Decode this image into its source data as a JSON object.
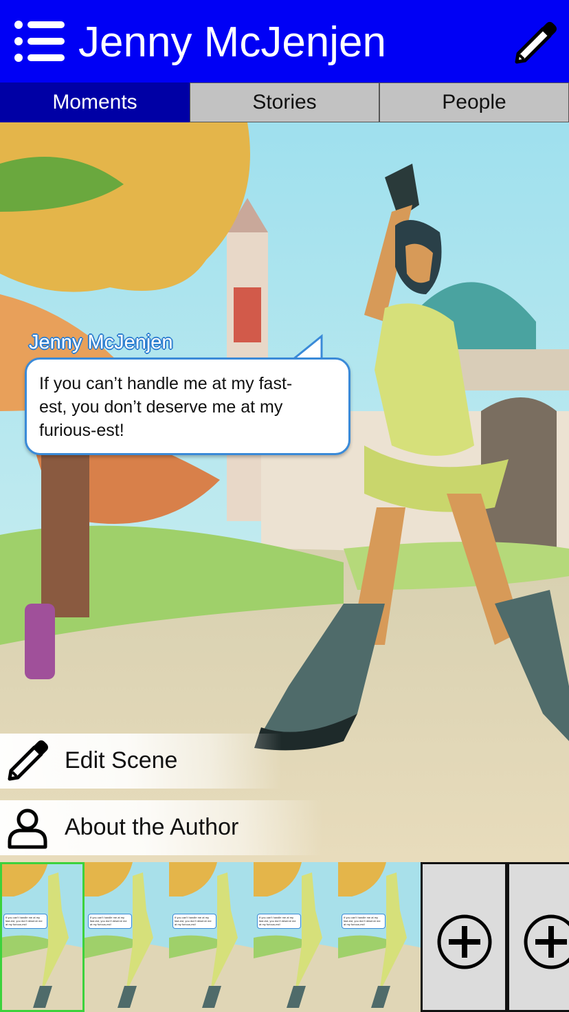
{
  "header": {
    "title": "Jenny McJenjen",
    "menu_icon": "menu-list-icon",
    "edit_icon": "pencil-icon",
    "background_color": "#0000f5"
  },
  "tabs": [
    {
      "label": "Moments",
      "active": true
    },
    {
      "label": "Stories",
      "active": false
    },
    {
      "label": "People",
      "active": false
    }
  ],
  "scene": {
    "speaker": "Jenny McJenjen",
    "dialogue": "If you can’t handle me at my fast-est, you don’t deserve me at my furious-est!",
    "dialogue_lines": [
      "If you can’t handle me at my fast-",
      "est, you don’t deserve me at my",
      "furious-est!"
    ],
    "accent_color": "#3a8ad8"
  },
  "actions": [
    {
      "label": "Edit Scene",
      "icon": "pencil-icon"
    },
    {
      "label": "About the Author",
      "icon": "person-icon"
    }
  ],
  "filmstrip": {
    "thumbnails": [
      {
        "selected": true,
        "caption": "If you can’t handle me at my fast-est, you don’t deserve me at my furious-est!"
      },
      {
        "selected": false,
        "caption": "If you can’t handle me at my fast-est, you don’t deserve me at my furious-est!"
      },
      {
        "selected": false,
        "caption": "If you can’t handle me at my fast-est, you don’t deserve me at my furious-est!"
      },
      {
        "selected": false,
        "caption": "If you can’t handle me at my fast-est, you don’t deserve me at my furious-est!"
      },
      {
        "selected": false,
        "caption": "If you can’t handle me at my fast-est, you don’t deserve me at my furious-est!"
      }
    ],
    "add_icon": "plus-circle-icon",
    "selected_color": "#3cd23c"
  }
}
